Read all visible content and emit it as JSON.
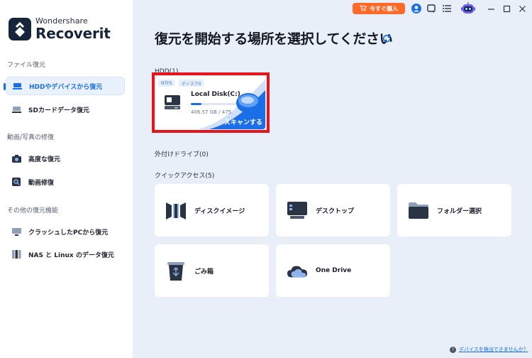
{
  "app": {
    "brand_sub": "Wondershare",
    "brand_main": "Recoverit"
  },
  "topbar": {
    "buy_label": "今すぐ購入"
  },
  "sidebar": {
    "sections": [
      {
        "title": "ファイル復元"
      },
      {
        "title": "動画/写真の修復"
      },
      {
        "title": "その他の復元機能"
      }
    ],
    "items": [
      {
        "label": "HDDやデバイスから復元",
        "icon": "hdd-icon",
        "active": true
      },
      {
        "label": "SDカードデータ復元",
        "icon": "sd-card-icon",
        "active": false
      },
      {
        "label": "高度な復元",
        "icon": "camera-icon",
        "active": false
      },
      {
        "label": "動画修復",
        "icon": "video-repair-icon",
        "active": false
      },
      {
        "label": "クラッシュしたPCから復元",
        "icon": "monitor-icon",
        "active": false
      },
      {
        "label": "NAS と Linux のデータ復元",
        "icon": "nas-icon",
        "active": false
      }
    ]
  },
  "main": {
    "title": "復元を開始する場所を選択してください",
    "hdd_section": "HDD(1)",
    "disk": {
      "tag_fs": "NTFS",
      "tag_type": "ディスク0",
      "name": "Local Disk(C:)",
      "size": "406.57 GB / 475.",
      "used_fraction": 0.22,
      "scan_label": "スキャンする"
    },
    "external_section": "外付けドライブ(0)",
    "quick_section": "クイックアクセス(5)",
    "quick_access": [
      {
        "label": "ディスクイメージ",
        "icon": "disk-image-icon"
      },
      {
        "label": "デスクトップ",
        "icon": "desktop-icon"
      },
      {
        "label": "フォルダー選択",
        "icon": "folder-icon"
      },
      {
        "label": "ごみ箱",
        "icon": "recycle-bin-icon"
      },
      {
        "label": "One Drive",
        "icon": "onedrive-icon"
      }
    ],
    "help_link": "デバイスを検出できませんか？"
  },
  "colors": {
    "accent": "#1a6ee8",
    "buy": "#ff6a28",
    "highlight": "#e5161b",
    "sidebar_bg": "#ffffff",
    "main_bg": "#e8eff9"
  }
}
